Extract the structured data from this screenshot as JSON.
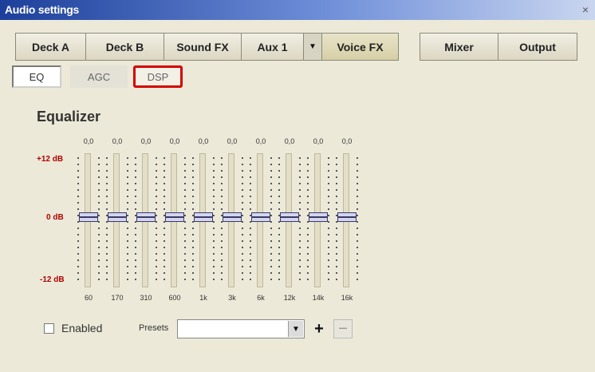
{
  "window": {
    "title": "Audio settings",
    "close_glyph": "×"
  },
  "tabs": {
    "deck_a": "Deck A",
    "deck_b": "Deck B",
    "sound_fx": "Sound FX",
    "aux": "Aux 1",
    "voice_fx": "Voice FX",
    "mixer": "Mixer",
    "output": "Output",
    "aux_arrow": "▼"
  },
  "subtabs": {
    "eq": "EQ",
    "agc": "AGC",
    "dsp": "DSP"
  },
  "equalizer": {
    "title": "Equalizer",
    "db_top": "+12 dB",
    "db_mid": "0 dB",
    "db_bottom": "-12 dB",
    "bands": [
      {
        "freq": "60",
        "value": "0,0"
      },
      {
        "freq": "170",
        "value": "0,0"
      },
      {
        "freq": "310",
        "value": "0,0"
      },
      {
        "freq": "600",
        "value": "0,0"
      },
      {
        "freq": "1k",
        "value": "0,0"
      },
      {
        "freq": "3k",
        "value": "0,0"
      },
      {
        "freq": "6k",
        "value": "0,0"
      },
      {
        "freq": "12k",
        "value": "0,0"
      },
      {
        "freq": "14k",
        "value": "0,0"
      },
      {
        "freq": "16k",
        "value": "0,0"
      }
    ]
  },
  "footer": {
    "enabled_label": "Enabled",
    "enabled_checked": false,
    "presets_label": "Presets",
    "presets_value": "",
    "presets_arrow": "▼",
    "plus": "+",
    "minus": "−"
  },
  "colors": {
    "title_bar": "#1c3f9a",
    "highlight": "#d60000",
    "db_label": "#b00000"
  }
}
